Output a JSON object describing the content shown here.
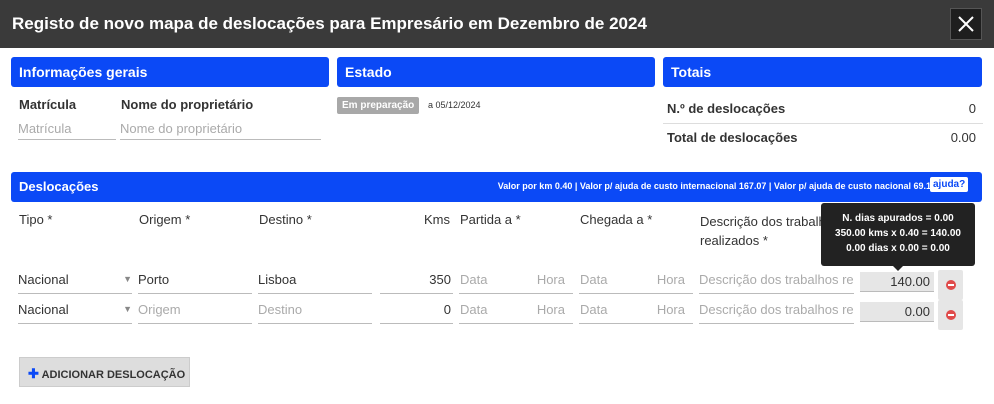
{
  "title": "Registo de novo mapa de deslocações para Empresário em Dezembro de 2024",
  "general": {
    "header": "Informações gerais",
    "matricula_label": "Matrícula",
    "owner_label": "Nome do proprietário",
    "matricula_placeholder": "Matrícula",
    "owner_placeholder": "Nome do proprietário"
  },
  "state": {
    "header": "Estado",
    "badge": "Em preparação",
    "date": "a 05/12/2024"
  },
  "totals": {
    "header": "Totais",
    "count_label": "N.º de deslocações",
    "count_value": "0",
    "total_label": "Total de deslocações",
    "total_value": "0.00"
  },
  "trips": {
    "header": "Deslocações",
    "rates": "Valor por km 0.40  |  Valor p/ ajuda de custo internacional 167.07  |  Valor p/ ajuda de custo nacional 69.19",
    "help": "ajuda?",
    "columns": {
      "tipo": "Tipo *",
      "origem": "Origem *",
      "destino": "Destino *",
      "kms": "Kms",
      "partida": "Partida a *",
      "chegada": "Chegada a *",
      "descricao": "Descrição dos trabalhos realizados *"
    },
    "rows": [
      {
        "tipo": "Nacional",
        "origem": "Porto",
        "destino": "Lisboa",
        "kms": "350",
        "data1": "Data",
        "hora1": "Hora",
        "data2": "Data",
        "hora2": "Hora",
        "descricao": "Descrição dos trabalhos re",
        "valor": "140.00"
      },
      {
        "tipo": "Nacional",
        "origem": "Origem",
        "destino": "Destino",
        "kms": "0",
        "data1": "Data",
        "hora1": "Hora",
        "data2": "Data",
        "hora2": "Hora",
        "descricao": "Descrição dos trabalhos re",
        "valor": "0.00"
      }
    ],
    "tooltip": [
      "N. dias apurados = 0.00",
      "350.00 kms x 0.40 = 140.00",
      "0.00 dias x 0.00 = 0.00"
    ],
    "add_button": "ADICIONAR DESLOCAÇÃO"
  }
}
